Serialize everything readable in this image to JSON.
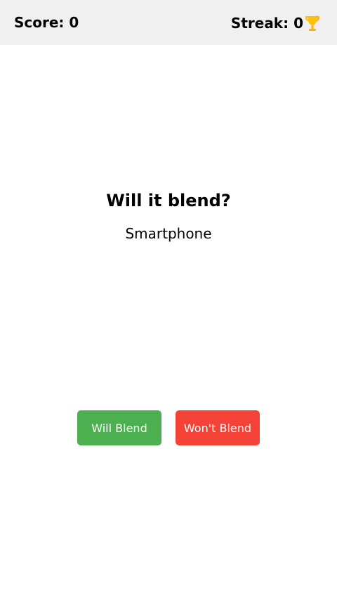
{
  "header": {
    "score_text": "Score: 0",
    "streak_text": "Streak: 0",
    "streak_icon": "trophy-icon"
  },
  "main": {
    "question": "Will it blend?",
    "item": "Smartphone"
  },
  "buttons": {
    "blend_label": "Will Blend",
    "no_blend_label": "Won't Blend"
  },
  "colors": {
    "header_bg": "#f0f0f0",
    "blend_button": "#4caf50",
    "no_blend_button": "#f44336",
    "trophy": "#ffc107"
  }
}
